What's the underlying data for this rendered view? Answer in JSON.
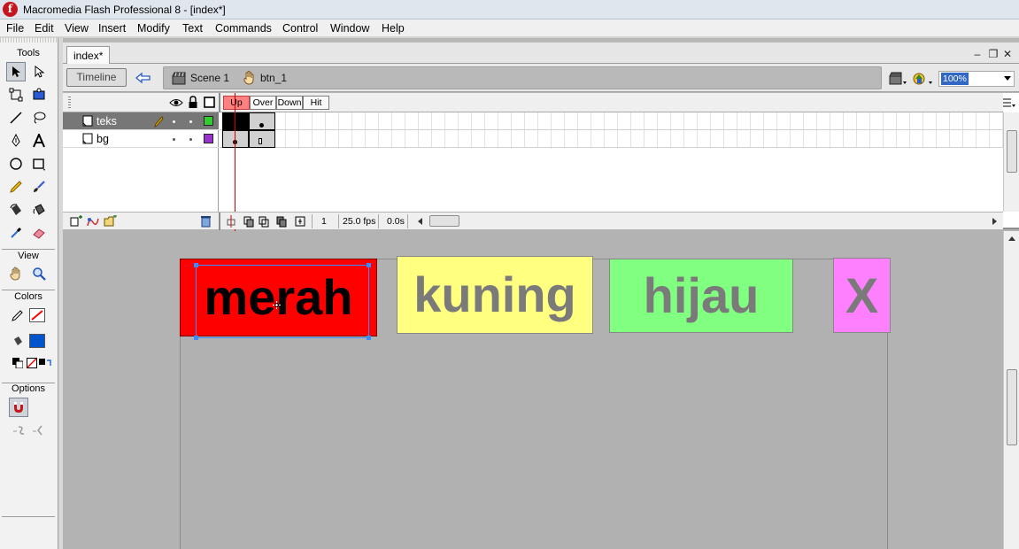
{
  "window": {
    "title": "Macromedia Flash Professional 8 - [index*]",
    "app_icon_letter": "f"
  },
  "menu": [
    "File",
    "Edit",
    "View",
    "Insert",
    "Modify",
    "Text",
    "Commands",
    "Control",
    "Window",
    "Help"
  ],
  "tools": {
    "header": "Tools",
    "view_label": "View",
    "colors_label": "Colors",
    "options_label": "Options",
    "stroke_color": "#ff0000",
    "fill_color": "#0055cc"
  },
  "document": {
    "tab_label": "index*",
    "minimize_glyph": "–",
    "restore_glyph": "❐",
    "close_glyph": "✕"
  },
  "editbar": {
    "timeline_button": "Timeline",
    "breadcrumbs": [
      {
        "label": "Scene 1",
        "icon": "scene-clapper-icon"
      },
      {
        "label": "btn_1",
        "icon": "button-hand-icon"
      }
    ],
    "zoom_value": "100%"
  },
  "timeline": {
    "button_states": [
      "Up",
      "Over",
      "Down",
      "Hit"
    ],
    "layers": [
      {
        "name": "teks",
        "selected": true,
        "outline_color": "#33cc33"
      },
      {
        "name": "bg",
        "selected": false,
        "outline_color": "#9933cc"
      }
    ],
    "current_frame": "1",
    "frame_rate": "25.0 fps",
    "elapsed_time": "0.0s"
  },
  "stage": {
    "buttons": [
      {
        "label": "merah",
        "color": "#ff0000"
      },
      {
        "label": "kuning",
        "color": "#ffff80"
      },
      {
        "label": "hijau",
        "color": "#80ff80"
      },
      {
        "label": "X",
        "color": "#ff80ff"
      }
    ]
  }
}
